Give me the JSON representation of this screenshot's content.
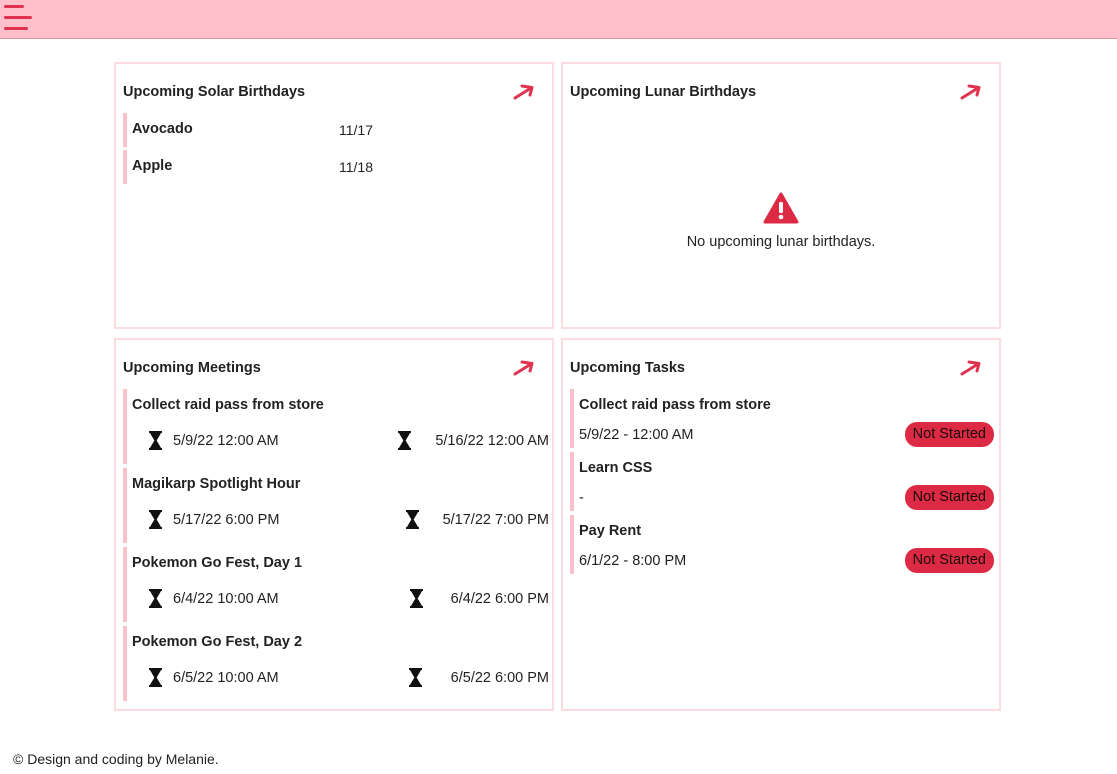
{
  "topbar": {
    "menu_icon": "hamburger-menu-icon"
  },
  "colors": {
    "accent": "#dd2a44",
    "topbar": "#ffc0cb",
    "row_border": "#fcc0cb",
    "card_border": "#fcdbe1"
  },
  "solar": {
    "title": "Upcoming Solar Birthdays",
    "link_icon": "arrow-up-right-icon",
    "items": [
      {
        "name": "Avocado",
        "date": "11/17"
      },
      {
        "name": "Apple",
        "date": "11/18"
      }
    ]
  },
  "lunar": {
    "title": "Upcoming Lunar Birthdays",
    "link_icon": "arrow-up-right-icon",
    "empty_icon": "warning-icon",
    "empty_text": "No upcoming lunar birthdays."
  },
  "meetings": {
    "title": "Upcoming Meetings",
    "link_icon": "arrow-up-right-icon",
    "items": [
      {
        "title": "Collect raid pass from store",
        "start": "5/9/22 12:00 AM",
        "end": "5/16/22 12:00 AM"
      },
      {
        "title": "Magikarp Spotlight Hour",
        "start": "5/17/22 6:00 PM",
        "end": "5/17/22 7:00 PM"
      },
      {
        "title": "Pokemon Go Fest, Day 1",
        "start": "6/4/22 10:00 AM",
        "end": "6/4/22 6:00 PM"
      },
      {
        "title": "Pokemon Go Fest, Day 2",
        "start": "6/5/22 10:00 AM",
        "end": "6/5/22 6:00 PM"
      }
    ]
  },
  "tasks": {
    "title": "Upcoming Tasks",
    "link_icon": "arrow-up-right-icon",
    "items": [
      {
        "title": "Collect raid pass from store",
        "due": "5/9/22 - 12:00 AM",
        "status": "Not Started"
      },
      {
        "title": "Learn CSS",
        "due": "-",
        "status": "Not Started"
      },
      {
        "title": "Pay Rent",
        "due": "6/1/22 - 8:00 PM",
        "status": "Not Started"
      }
    ]
  },
  "footer": {
    "text": "© Design and coding by Melanie."
  }
}
